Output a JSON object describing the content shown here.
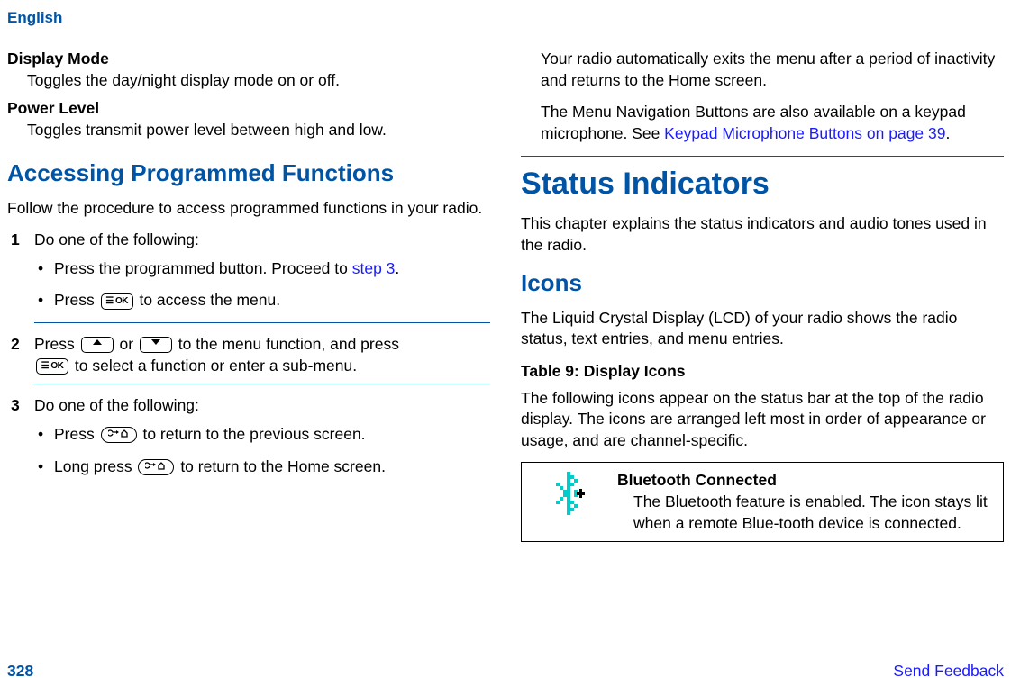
{
  "header": {
    "language": "English"
  },
  "left": {
    "displayMode": {
      "term": "Display Mode",
      "def": "Toggles the day/night display mode on or off."
    },
    "powerLevel": {
      "term": "Power Level",
      "def": "Toggles transmit power level between high and low."
    },
    "h2": "Accessing Programmed Functions",
    "intro": "Follow the procedure to access programmed functions in your radio.",
    "step1": {
      "num": "1",
      "text": "Do one of the following:",
      "b1a": "Press the programmed button. Proceed to ",
      "b1link": "step 3",
      "b1b": ".",
      "b2a": "Press ",
      "b2b": " to access the menu."
    },
    "step2": {
      "num": "2",
      "a": "Press ",
      "mid": " or ",
      "b": " to the menu function, and press ",
      "c": " to select a function or enter a sub-menu."
    },
    "step3": {
      "num": "3",
      "text": "Do one of the following:",
      "b1a": "Press ",
      "b1b": " to return to the previous screen.",
      "b2a": "Long press ",
      "b2b": " to return to the Home screen."
    }
  },
  "right": {
    "p1": "Your radio automatically exits the menu after a period of inactivity and returns to the Home screen.",
    "p2a": "The Menu Navigation Buttons are also available on a keypad microphone. See ",
    "p2link": "Keypad Microphone Buttons on page 39",
    "p2b": ".",
    "h1": "Status Indicators",
    "p3": "This chapter explains the status indicators and audio tones used in the radio.",
    "h2": "Icons",
    "p4": "The Liquid Crystal Display (LCD) of your radio shows the radio status, text entries, and menu entries.",
    "tableTitle": "Table 9: Display Icons",
    "tableIntro": "The following icons appear on the status bar at the top of the radio display. The icons are arranged left most in order of appearance or usage, and are channel-specific.",
    "row1": {
      "title": "Bluetooth Connected",
      "desc": "The Bluetooth feature is enabled. The icon stays lit when a remote Blue‐tooth device is connected."
    }
  },
  "footer": {
    "page": "328",
    "feedback": "Send Feedback"
  },
  "icons": {
    "ok": "☰ OK"
  }
}
